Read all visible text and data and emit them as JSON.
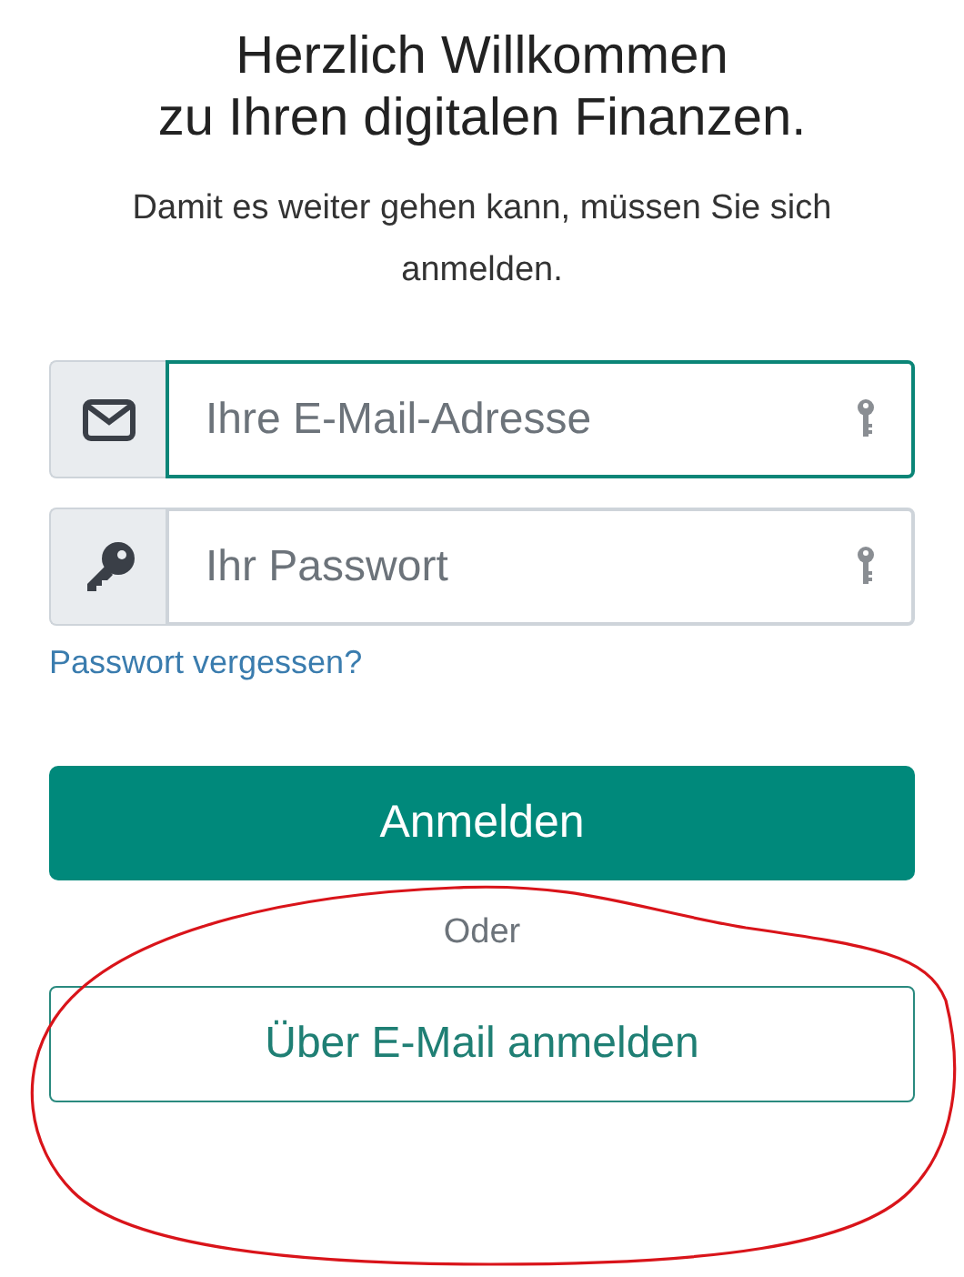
{
  "heading": {
    "lines": [
      "Herzlich Willkommen",
      "zu Ihren digitalen Finanzen."
    ]
  },
  "intro": "Damit es weiter gehen kann, müssen Sie sich anmelden.",
  "fields": [
    {
      "kind": "email",
      "placeholder": "Ihre E-Mail-Adresse",
      "focused": true
    },
    {
      "kind": "password",
      "placeholder": "Ihr Passwort",
      "focused": false
    }
  ],
  "forgot_link": "Passwort vergessen?",
  "login_button": "Anmelden",
  "separator": "Oder",
  "email_login_button": "Über E-Mail anmelden"
}
